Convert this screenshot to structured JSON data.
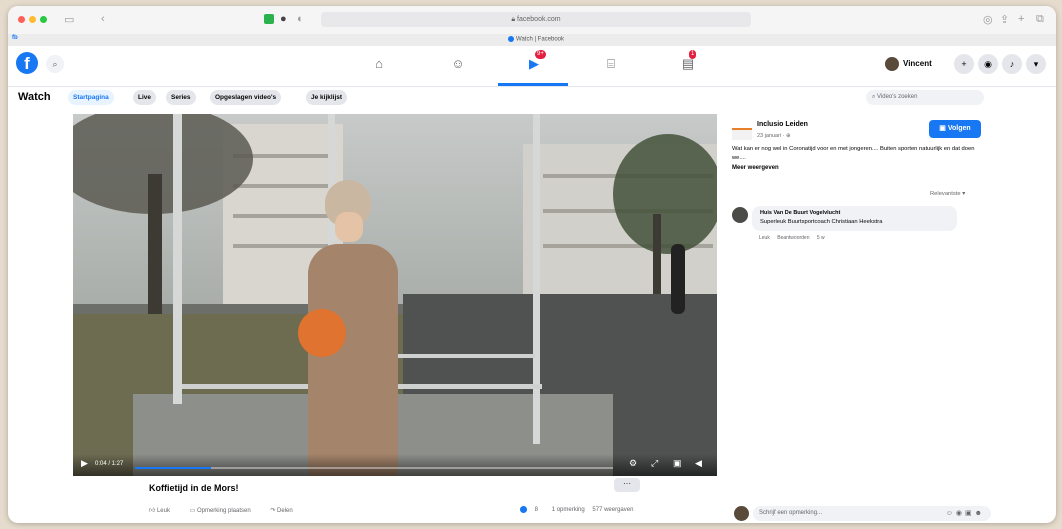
{
  "browser": {
    "url": "facebook.com",
    "tab_title": "Watch | Facebook"
  },
  "header": {
    "logo": "f",
    "user_name": "Vincent",
    "watch_badge": "9+",
    "notif_badge": "1"
  },
  "watch": {
    "title": "Watch",
    "pills": [
      "Startpagina",
      "Live",
      "Series",
      "Opgeslagen video's",
      "Je kijklijst"
    ],
    "search_placeholder": "Video's zoeken"
  },
  "video": {
    "timer": "0:04 / 1:27",
    "progress": 0.16,
    "title": "Koffietijd in de Mors!",
    "more_label": "···",
    "actions": [
      "Leuk",
      "Opmerking plaatsen",
      "Delen"
    ],
    "reactions_count": "8",
    "comments_count": "1 opmerking",
    "views": "577 weergaven"
  },
  "panel": {
    "page_name": "Inclusio Leiden",
    "page_meta": "23 januari · ⊕",
    "follow_label": "Volgen",
    "description": "Wat kan er nog wel in Coronatijd voor en met jongeren.... Buiten sporten natuurlijk en dat doen we....",
    "more_label": "Meer weergeven",
    "sort_label": "Relevantste ▾",
    "comment": {
      "name": "Huis Van De Buurt Vogelvlucht",
      "text": "Superleuk Buurtsportcoach Christiaan Heekstra",
      "actions": [
        "Leuk",
        "Beantwoorden",
        "5 w"
      ]
    },
    "write_placeholder": "Schrijf een opmerking..."
  },
  "colors": {
    "accent": "#1877f2",
    "badge": "#e41e3f"
  }
}
